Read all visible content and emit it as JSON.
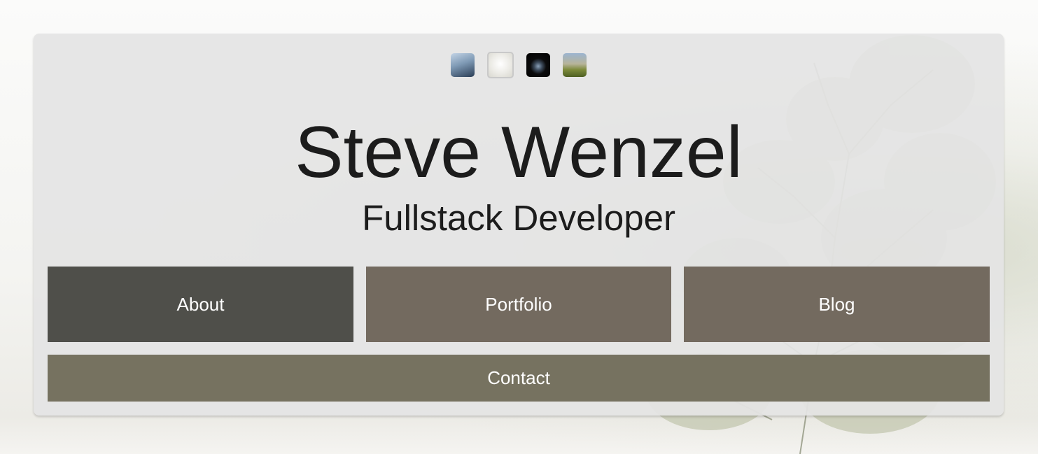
{
  "background": {
    "description_icon": "tree-photo"
  },
  "themes": [
    {
      "name": "blue-sky-theme",
      "color": "#7f9ab5"
    },
    {
      "name": "white-fog-theme",
      "color": "#ecebe6",
      "selected": true
    },
    {
      "name": "dark-space-theme",
      "color": "#0b0b0c"
    },
    {
      "name": "green-landscape-theme",
      "color": "#7c8a3a"
    }
  ],
  "header": {
    "name": "Steve Wenzel",
    "role": "Fullstack Developer"
  },
  "nav": {
    "about": "About",
    "portfolio": "Portfolio",
    "blog": "Blog",
    "contact": "Contact"
  },
  "colors": {
    "card_bg": "#e4e4e4",
    "about_bg": "#4f4f4a",
    "portfolio_bg": "#736a5f",
    "blog_bg": "#736a5f",
    "contact_bg": "#767260",
    "text": "#1c1c1c",
    "button_text": "#ffffff"
  }
}
